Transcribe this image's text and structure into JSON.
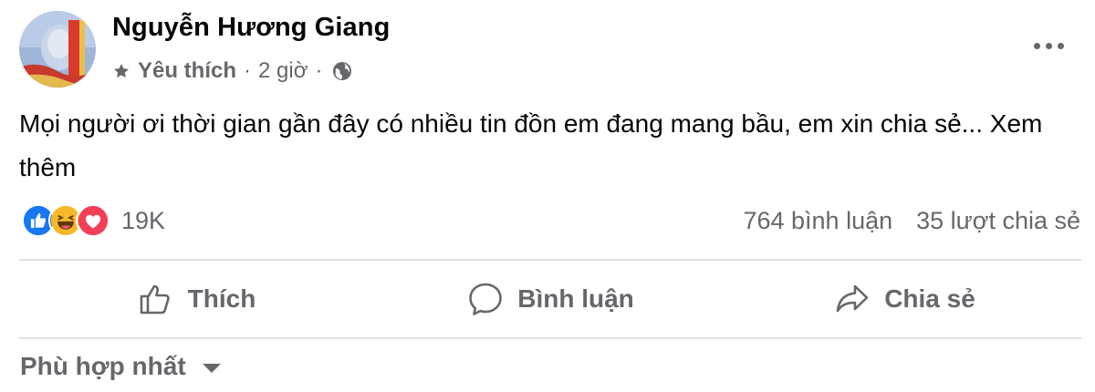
{
  "post": {
    "author": "Nguyễn Hương Giang",
    "audience_label": "Yêu thích",
    "separator": "·",
    "time": "2 giờ",
    "text": "Mọi người ơi thời gian gần đây có nhiều tin đồn em đang mang bầu, em xin chia sẻ...",
    "see_more": "Xem thêm",
    "reaction_icons": [
      "like-reaction-icon",
      "haha-reaction-icon",
      "love-reaction-icon"
    ],
    "reaction_count": "19K",
    "comment_count": "764 bình luận",
    "share_count": "35 lượt chia sẻ"
  },
  "actions": {
    "like": "Thích",
    "comment": "Bình luận",
    "share": "Chia sẻ"
  },
  "sort": {
    "label": "Phù hợp nhất"
  },
  "colors": {
    "text_primary": "#050505",
    "text_secondary": "#65676b",
    "divider": "#dfe1e5",
    "like_blue": "#1877f2",
    "love_red": "#f33e58",
    "haha_yellow": "#f7b928"
  }
}
